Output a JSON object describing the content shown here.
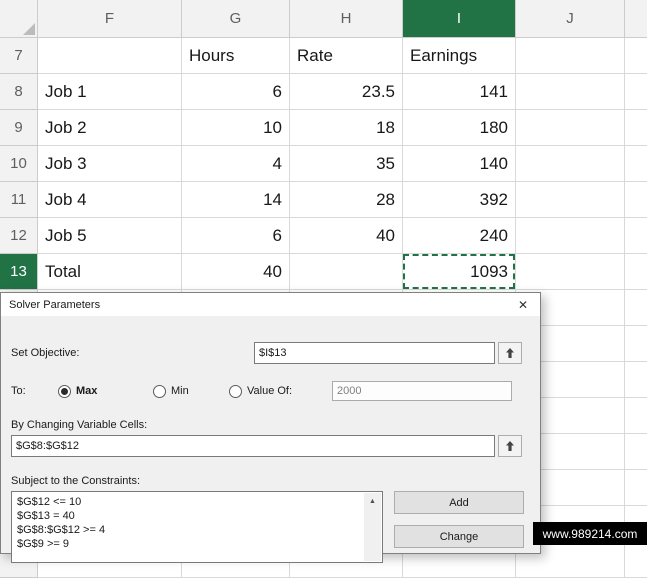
{
  "spreadsheet": {
    "col_headers": [
      "F",
      "G",
      "H",
      "I",
      "J"
    ],
    "selected_column": "I",
    "selected_row": "13",
    "active_cell": "I13",
    "rows": [
      {
        "num": "7",
        "f": "",
        "g": "Hours",
        "h": "Rate",
        "i": "Earnings"
      },
      {
        "num": "8",
        "f": "Job 1",
        "g": "6",
        "h": "23.5",
        "i": "141"
      },
      {
        "num": "9",
        "f": "Job 2",
        "g": "10",
        "h": "18",
        "i": "180"
      },
      {
        "num": "10",
        "f": "Job 3",
        "g": "4",
        "h": "35",
        "i": "140"
      },
      {
        "num": "11",
        "f": "Job 4",
        "g": "14",
        "h": "28",
        "i": "392"
      },
      {
        "num": "12",
        "f": "Job 5",
        "g": "6",
        "h": "40",
        "i": "240"
      },
      {
        "num": "13",
        "f": "Total",
        "g": "40",
        "h": "",
        "i": "1093"
      }
    ]
  },
  "dialog": {
    "title": "Solver Parameters",
    "close_icon": "✕",
    "set_objective_label": "Set Objective:",
    "set_objective_value": "$I$13",
    "to_label": "To:",
    "option_max": "Max",
    "option_min": "Min",
    "option_value_of": "Value Of:",
    "selected_option": "Max",
    "value_of_value": "2000",
    "changing_label": "By Changing Variable Cells:",
    "changing_value": "$G$8:$G$12",
    "constraints_label": "Subject to the Constraints:",
    "constraints": [
      "$G$12 <= 10",
      "$G$13 = 40",
      "$G$8:$G$12 >= 4",
      "$G$9 >= 9"
    ],
    "add_button": "Add",
    "change_button": "Change",
    "scroll_up_icon": "▲"
  },
  "watermark": "www.989214.com",
  "colors": {
    "accent_green": "#217346"
  }
}
